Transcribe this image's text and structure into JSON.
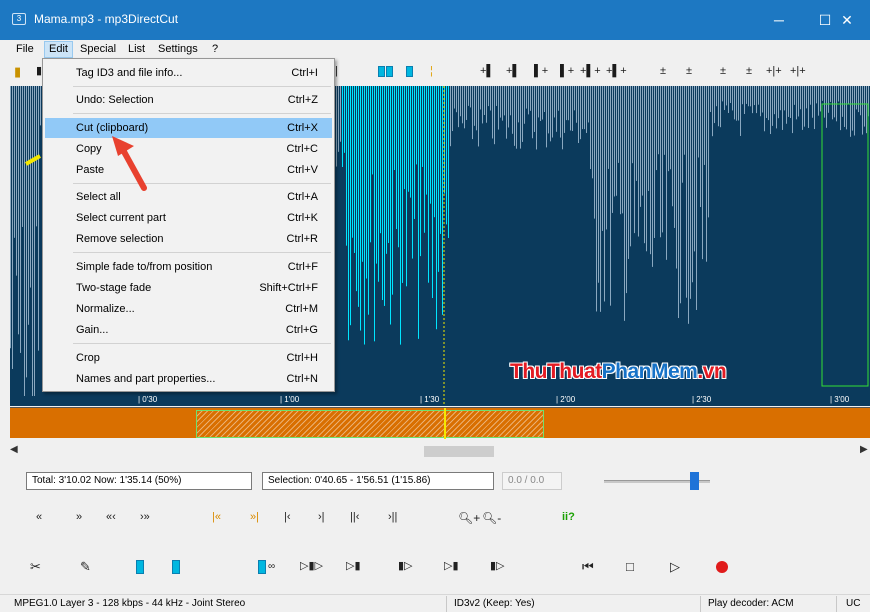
{
  "window": {
    "icon_text": "3",
    "title": "Mama.mp3 - mp3DirectCut",
    "controls": {
      "minimize": "─",
      "maximize": "☐",
      "close": "✕"
    }
  },
  "menubar": {
    "items": [
      {
        "label": "File"
      },
      {
        "label": "Edit"
      },
      {
        "label": "Special"
      },
      {
        "label": "List"
      },
      {
        "label": "Settings"
      },
      {
        "label": "?"
      }
    ]
  },
  "edit_menu": {
    "items": [
      {
        "label": "Tag ID3 and file info...",
        "shortcut": "Ctrl+I"
      },
      {
        "label": "Undo: Selection",
        "shortcut": "Ctrl+Z"
      },
      {
        "label": "Cut (clipboard)",
        "shortcut": "Ctrl+X"
      },
      {
        "label": "Copy",
        "shortcut": "Ctrl+C"
      },
      {
        "label": "Paste",
        "shortcut": "Ctrl+V"
      },
      {
        "label": "Select all",
        "shortcut": "Ctrl+A"
      },
      {
        "label": "Select current part",
        "shortcut": "Ctrl+K"
      },
      {
        "label": "Remove selection",
        "shortcut": "Ctrl+R"
      },
      {
        "label": "Simple fade to/from position",
        "shortcut": "Ctrl+F"
      },
      {
        "label": "Two-stage fade",
        "shortcut": "Shift+Ctrl+F"
      },
      {
        "label": "Normalize...",
        "shortcut": "Ctrl+M"
      },
      {
        "label": "Gain...",
        "shortcut": "Ctrl+G"
      },
      {
        "label": "Crop",
        "shortcut": "Ctrl+H"
      },
      {
        "label": "Names and part properties...",
        "shortcut": "Ctrl+N"
      }
    ],
    "highlighted": "Cut (clipboard)"
  },
  "timeline": {
    "ticks": [
      "| 0'30",
      "| 1'00",
      "| 1'30",
      "| 2'00",
      "| 2'30",
      "| 3'00"
    ]
  },
  "info": {
    "total_now": "Total: 3'10.02  Now: 1'35.14  (50%)",
    "selection": "Selection: 0'40.65 - 1'56.51 (1'15.86)",
    "counter": "0.0 / 0.0",
    "volume_level": 0.85
  },
  "nav_icons": [
    "«",
    "»",
    "«‹",
    "›»",
    "|«",
    "»|",
    "|‹",
    "›|",
    "||‹",
    "›||",
    "zoom-in",
    "zoom-out",
    "ii?"
  ],
  "statusbar": {
    "format": "MPEG1.0 Layer 3 - 128 kbps - 44 kHz - Joint Stereo",
    "id3": "ID3v2 (Keep: Yes)",
    "decoder": "Play decoder: ACM",
    "mode": "UC"
  },
  "watermark": {
    "part1": "ThuThuat",
    "part2": "PhanMem",
    "part3": ".vn"
  },
  "colors": {
    "titlebar": "#1d78c2",
    "waveform_bg": "#0b3a5c",
    "waveform_fg": "#8aa8c0",
    "waveform_highlight": "#00e5ff",
    "overview": "#d96f00",
    "menu_highlight": "#91c9f7",
    "pointer_arrow": "#e8412f"
  }
}
